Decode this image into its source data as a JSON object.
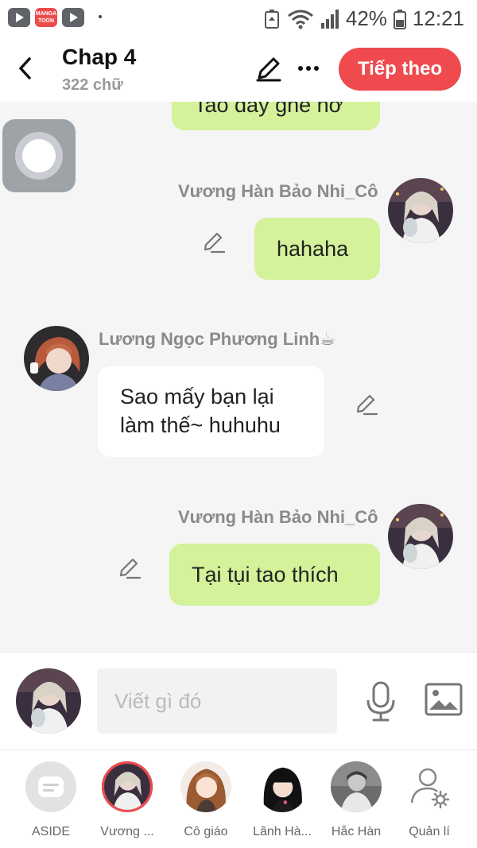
{
  "status": {
    "battery": "42%",
    "time": "12:21",
    "manga_app_text": "MANGA TOON"
  },
  "header": {
    "title": "Chap 4",
    "subtitle": "322 chữ",
    "next_label": "Tiếp theo"
  },
  "messages": [
    {
      "text": "Tao đây ghê nơ",
      "side": "right"
    },
    {
      "name": "Vương Hàn Bảo Nhi_Cô",
      "text": "hahaha",
      "side": "right"
    },
    {
      "name": "Lương Ngọc Phương Linh☕",
      "line1": "Sao mấy bạn lại",
      "line2": "làm thế~ huhuhu",
      "side": "left"
    },
    {
      "name": "Vương Hàn Bảo Nhi_Cô",
      "text": "Tại tụi tao thích",
      "side": "right"
    }
  ],
  "composer": {
    "placeholder": "Viết gì đó"
  },
  "characters": [
    {
      "label": "ASIDE"
    },
    {
      "label": "Vương ..."
    },
    {
      "label": "Cô giáo"
    },
    {
      "label": "Lãnh Hà..."
    },
    {
      "label": "Hắc Hàn"
    },
    {
      "label": "Quản lí"
    }
  ],
  "colors": {
    "accent": "#ef4a4e",
    "green_bubble": "#d3f29a",
    "white_bubble": "#ffffff",
    "background": "#f5f5f5"
  },
  "icons": {
    "back": "back-arrow-icon",
    "edit": "pencil-icon",
    "more": "more-dots-icon",
    "mic": "microphone-icon",
    "image": "image-icon",
    "manage": "user-gear-icon"
  }
}
